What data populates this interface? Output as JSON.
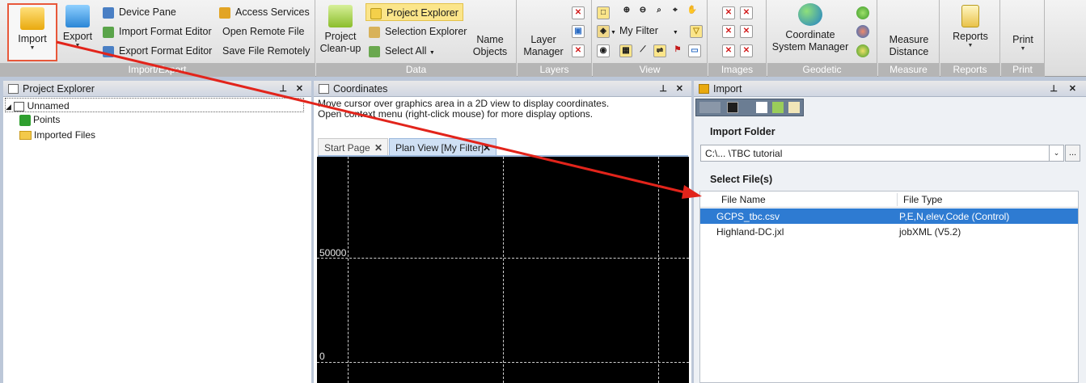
{
  "ribbon": {
    "import_export": {
      "import_label": "Import",
      "export_label": "Export",
      "device_pane": "Device Pane",
      "import_format_editor": "Import Format Editor",
      "export_format_editor": "Export Format Editor",
      "access_services": "Access Services",
      "open_remote_file": "Open Remote File",
      "save_file_remotely": "Save File Remotely",
      "group_label": "Import/Export"
    },
    "data": {
      "project_cleanup": "Project Clean-up",
      "project_explorer": "Project Explorer",
      "selection_explorer": "Selection Explorer",
      "select_all": "Select All",
      "name_objects": "Name Objects",
      "group_label": "Data"
    },
    "layers": {
      "layer_manager": "Layer Manager",
      "group_label": "Layers"
    },
    "view": {
      "filter_value": "My Filter",
      "group_label": "View"
    },
    "images": {
      "group_label": "Images"
    },
    "geodetic": {
      "coord_system_manager": "Coordinate System Manager",
      "group_label": "Geodetic"
    },
    "measure": {
      "measure_distance": "Measure Distance",
      "group_label": "Measure"
    },
    "reports": {
      "reports_label": "Reports",
      "group_label": "Reports"
    },
    "print": {
      "print_label": "Print",
      "group_label": "Print"
    }
  },
  "project_explorer": {
    "title": "Project Explorer",
    "root": "Unnamed",
    "items": [
      "Points",
      "Imported Files"
    ]
  },
  "coordinates": {
    "title": "Coordinates",
    "line1": "Move cursor over graphics area in a 2D view to display coordinates.",
    "line2": "Open context menu (right-click mouse) for more display options."
  },
  "tabs": {
    "start_page": "Start Page",
    "plan_view": "Plan View [My Filter]"
  },
  "plan": {
    "label_50000": "50000",
    "label_0": "0"
  },
  "import_panel": {
    "title": "Import",
    "folder_heading": "Import Folder",
    "folder_value": "C:\\... \\TBC tutorial",
    "browse": "...",
    "select_heading": "Select File(s)",
    "columns": [
      "File Name",
      "File Type"
    ],
    "rows": [
      {
        "name": "GCPS_tbc.csv",
        "type": "P,E,N,elev,Code (Control)"
      },
      {
        "name": "Highland-DC.jxl",
        "type": "jobXML (V5.2)"
      }
    ]
  }
}
